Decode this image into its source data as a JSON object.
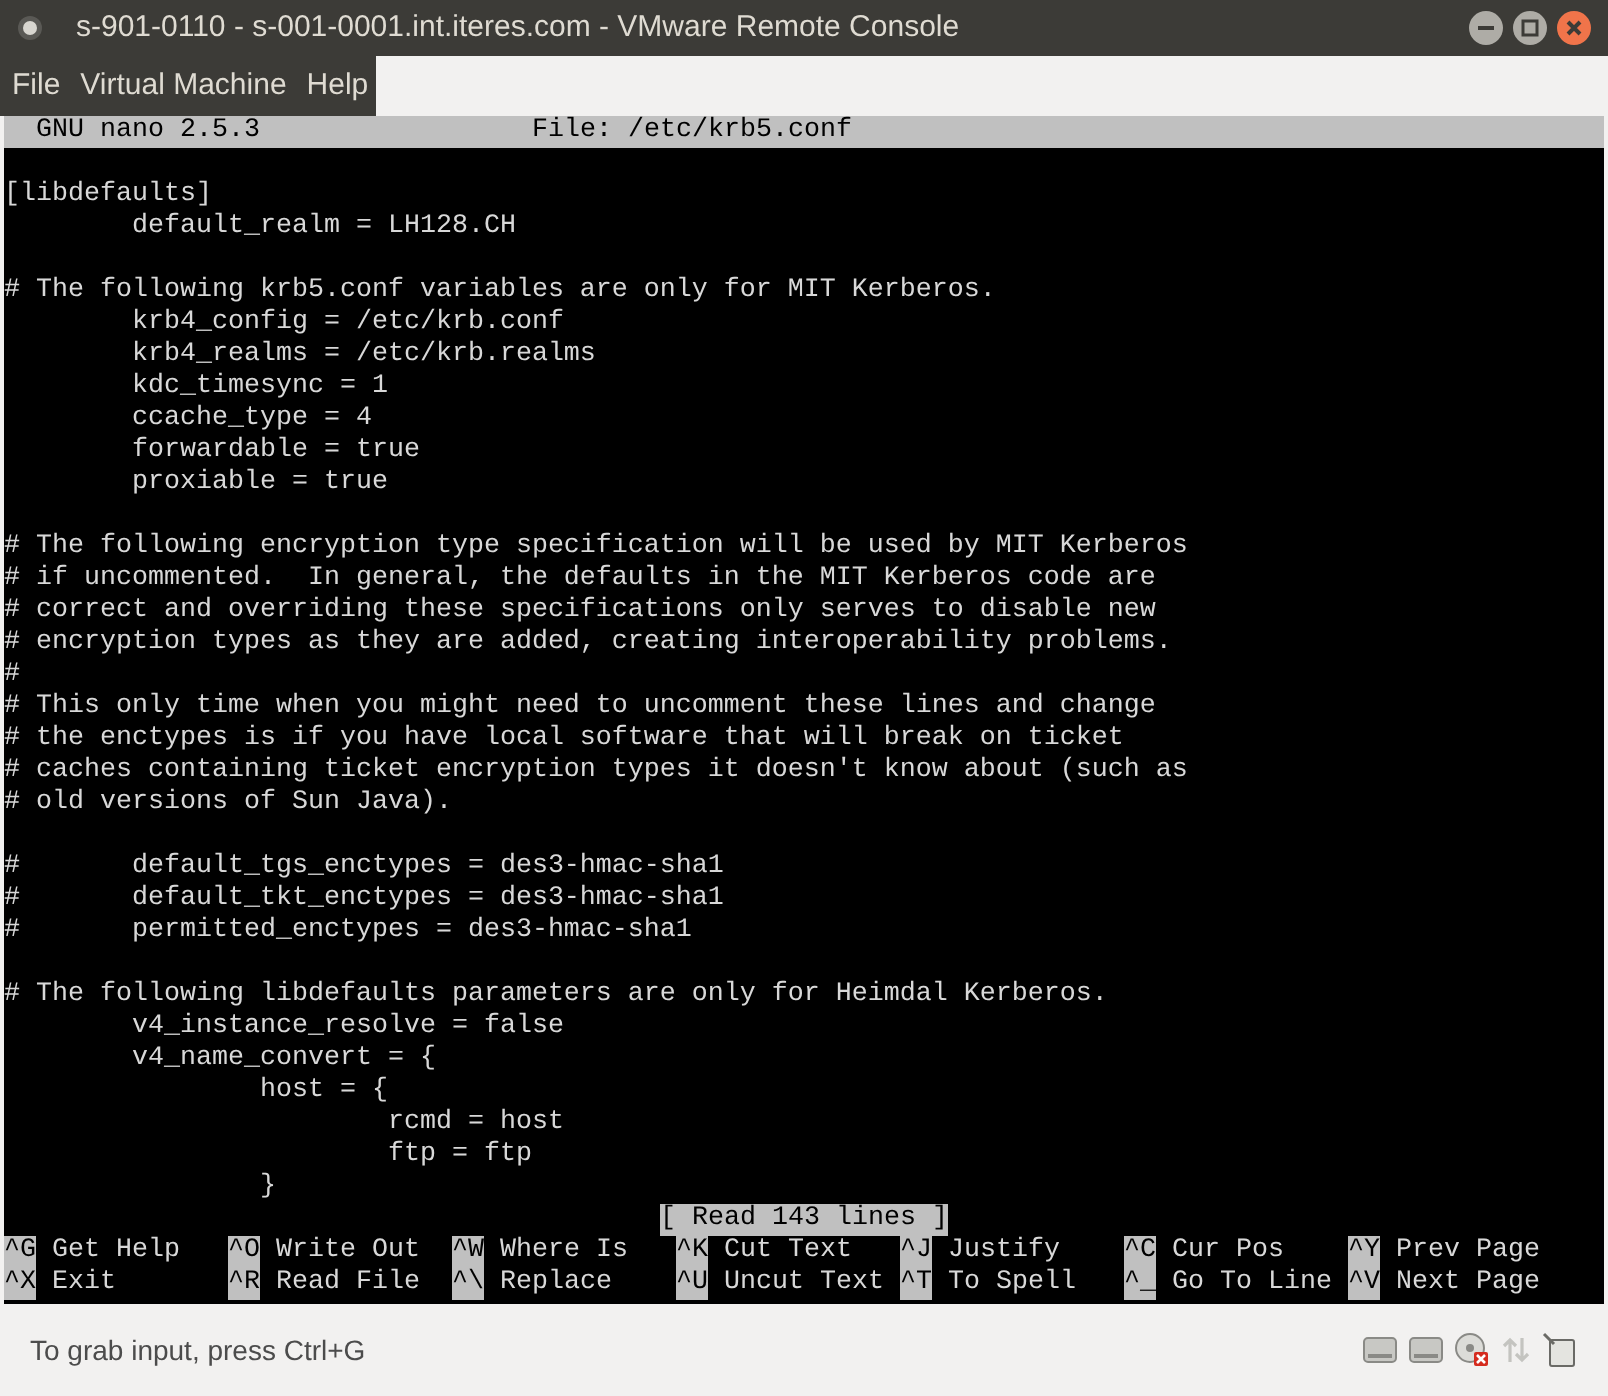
{
  "window": {
    "title": "s-901-0110 - s-001-0001.int.iteres.com - VMware Remote Console"
  },
  "menu": [
    "File",
    "Virtual Machine",
    "Help"
  ],
  "nano": {
    "version": "GNU nano 2.5.3",
    "file": "File: /etc/krb5.conf"
  },
  "lines": [
    {
      "kind": "text",
      "text": "[libdefaults]"
    },
    {
      "kind": "text",
      "text": "        default_realm = LH128.CH"
    },
    {
      "kind": "blank"
    },
    {
      "kind": "text",
      "text": "# The following krb5.conf variables are only for MIT Kerberos."
    },
    {
      "kind": "text",
      "text": "        krb4_config = /etc/krb.conf"
    },
    {
      "kind": "text",
      "text": "        krb4_realms = /etc/krb.realms"
    },
    {
      "kind": "text",
      "text": "        kdc_timesync = 1"
    },
    {
      "kind": "text",
      "text": "        ccache_type = 4"
    },
    {
      "kind": "text",
      "text": "        forwardable = true"
    },
    {
      "kind": "text",
      "text": "        proxiable = true"
    },
    {
      "kind": "blank"
    },
    {
      "kind": "text",
      "text": "# The following encryption type specification will be used by MIT Kerberos"
    },
    {
      "kind": "text",
      "text": "# if uncommented.  In general, the defaults in the MIT Kerberos code are"
    },
    {
      "kind": "text",
      "text": "# correct and overriding these specifications only serves to disable new"
    },
    {
      "kind": "text",
      "text": "# encryption types as they are added, creating interoperability problems."
    },
    {
      "kind": "text",
      "text": "#"
    },
    {
      "kind": "text",
      "text": "# This only time when you might need to uncomment these lines and change"
    },
    {
      "kind": "text",
      "text": "# the enctypes is if you have local software that will break on ticket"
    },
    {
      "kind": "text",
      "text": "# caches containing ticket encryption types it doesn't know about (such as"
    },
    {
      "kind": "text",
      "text": "# old versions of Sun Java)."
    },
    {
      "kind": "blank"
    },
    {
      "kind": "text",
      "text": "#       default_tgs_enctypes = des3-hmac-sha1"
    },
    {
      "kind": "text",
      "text": "#       default_tkt_enctypes = des3-hmac-sha1"
    },
    {
      "kind": "text",
      "text": "#       permitted_enctypes = des3-hmac-sha1"
    },
    {
      "kind": "blank"
    },
    {
      "kind": "text",
      "text": "# The following libdefaults parameters are only for Heimdal Kerberos."
    },
    {
      "kind": "text",
      "text": "        v4_instance_resolve = false"
    },
    {
      "kind": "text",
      "text": "        v4_name_convert = {"
    },
    {
      "kind": "text",
      "text": "                host = {"
    },
    {
      "kind": "text",
      "text": "                        rcmd = host"
    },
    {
      "kind": "text",
      "text": "                        ftp = ftp"
    },
    {
      "kind": "text",
      "text": "                }"
    }
  ],
  "message": "[ Read 143 lines ]",
  "shortcuts": [
    [
      {
        "key": "^G",
        "label": "Get Help"
      },
      {
        "key": "^O",
        "label": "Write Out"
      },
      {
        "key": "^W",
        "label": "Where Is"
      },
      {
        "key": "^K",
        "label": "Cut Text"
      },
      {
        "key": "^J",
        "label": "Justify"
      },
      {
        "key": "^C",
        "label": "Cur Pos"
      },
      {
        "key": "^Y",
        "label": "Prev Page"
      }
    ],
    [
      {
        "key": "^X",
        "label": "Exit"
      },
      {
        "key": "^R",
        "label": "Read File"
      },
      {
        "key": "^\\",
        "label": "Replace"
      },
      {
        "key": "^U",
        "label": "Uncut Text"
      },
      {
        "key": "^T",
        "label": "To Spell"
      },
      {
        "key": "^_",
        "label": "Go To Line"
      },
      {
        "key": "^V",
        "label": "Next Page"
      }
    ]
  ],
  "status_bar": {
    "text": "To grab input, press Ctrl+G"
  }
}
